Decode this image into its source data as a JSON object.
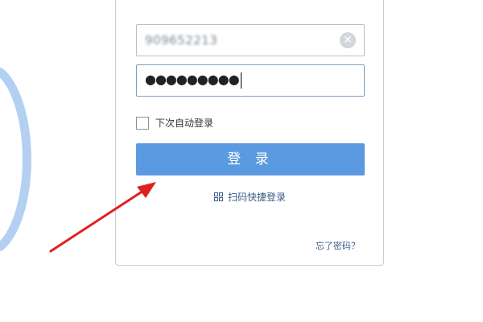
{
  "login_form": {
    "account_value": "909652213",
    "clear_icon": "close-icon",
    "password_mask": "●●●●●●●●●",
    "remember_label": "下次自动登录",
    "login_button_label": "登 录",
    "qr_login_label": "扫码快捷登录",
    "qr_icon": "qr-code-icon",
    "forgot_password_label": "忘了密码？"
  },
  "colors": {
    "login_button": "#5b9ae0",
    "link_text": "#3b5e86",
    "decorative_arc": "#b3d0f3",
    "annotation_arrow": "#e02020"
  },
  "annotation": {
    "icon": "red-arrow-pointing-to-login-button"
  }
}
